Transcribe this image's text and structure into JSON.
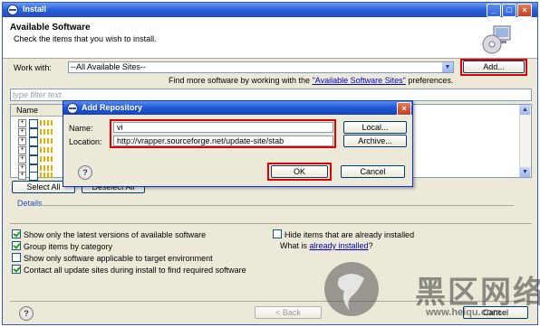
{
  "window": {
    "title": "Install"
  },
  "header": {
    "title": "Available Software",
    "subtitle": "Check the items that you wish to install."
  },
  "work_with": {
    "label": "Work with:",
    "value": "--All Available Sites--",
    "add_button": "Add...",
    "hint_prefix": "Find more software by working with the ",
    "hint_link": "\"Available Software Sites\"",
    "hint_suffix": " preferences."
  },
  "filter": {
    "placeholder": "type filter text"
  },
  "tree": {
    "column": "Name",
    "row_count": 7
  },
  "buttons": {
    "select_all": "Select All",
    "deselect_all": "Deselect All"
  },
  "details": {
    "label": "Details"
  },
  "options": {
    "latest_only": {
      "label": "Show only the latest versions of available software",
      "checked": true
    },
    "group_by_category": {
      "label": "Group items by category",
      "checked": true
    },
    "target_env": {
      "label": "Show only software applicable to target environment",
      "checked": false
    },
    "contact_sites": {
      "label": "Contact all update sites during install to find required software",
      "checked": true
    },
    "hide_installed": {
      "label": "Hide items that are already installed",
      "checked": false
    },
    "what_is_prefix": "What is ",
    "what_is_link": "already installed",
    "what_is_suffix": "?"
  },
  "footer": {
    "back": "< Back",
    "cancel": "Cancel"
  },
  "dialog": {
    "title": "Add Repository",
    "name_label": "Name:",
    "name_value": "vi",
    "location_label": "Location:",
    "location_value": "http://vrapper.sourceforge.net/update-site/stab",
    "local_button": "Local...",
    "archive_button": "Archive...",
    "ok_button": "OK",
    "cancel_button": "Cancel"
  },
  "watermark": {
    "text": "黑区网络",
    "url": "www.heiqu.com"
  },
  "colors": {
    "highlight_red": "#e00000",
    "titlebar_blue": "#2a5fd8",
    "link_blue": "#0000cc"
  }
}
